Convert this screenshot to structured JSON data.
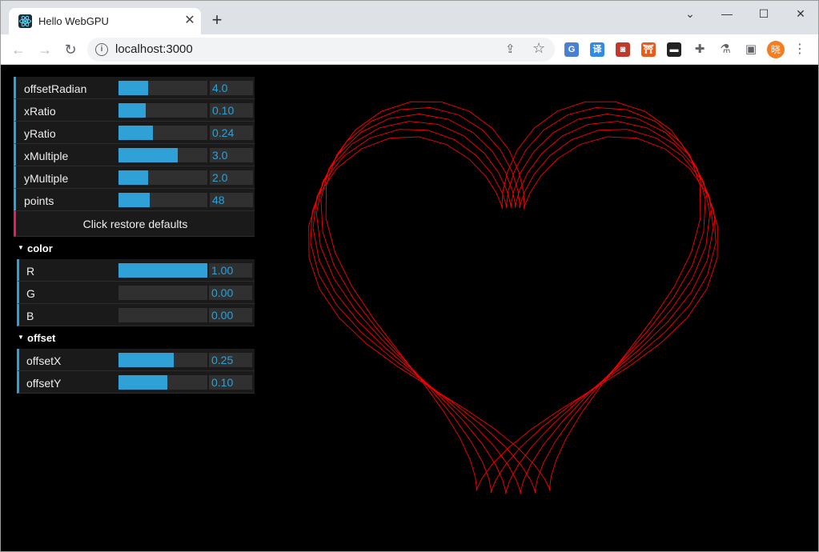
{
  "browser": {
    "tab_title": "Hello WebGPU",
    "tab_close": "✕",
    "new_tab": "+",
    "url": "localhost:3000",
    "profile_initial": "晓",
    "extensions": [
      {
        "name": "google-translate-icon",
        "glyph": "G",
        "color": "#4a7fd6"
      },
      {
        "name": "translate-icon",
        "glyph": "译",
        "color": "#2f8be6"
      },
      {
        "name": "extension-red-icon",
        "glyph": "◙",
        "color": "#c0392b"
      },
      {
        "name": "extension-orange-icon",
        "glyph": "⛩",
        "color": "#e85b1a"
      },
      {
        "name": "extension-dark-icon",
        "glyph": "▬",
        "color": "#222222"
      },
      {
        "name": "puzzle-icon",
        "glyph": "✚",
        "color": "#5f6368"
      },
      {
        "name": "flask-icon",
        "glyph": "⚗",
        "color": "#5f6368"
      },
      {
        "name": "sidepanel-icon",
        "glyph": "▣",
        "color": "#5f6368"
      }
    ]
  },
  "gui": {
    "controls": [
      {
        "label": "offsetRadian",
        "value": "4.0",
        "fraction": 0.33
      },
      {
        "label": "xRatio",
        "value": "0.10",
        "fraction": 0.31
      },
      {
        "label": "yRatio",
        "value": "0.24",
        "fraction": 0.39
      },
      {
        "label": "xMultiple",
        "value": "3.0",
        "fraction": 0.67
      },
      {
        "label": "yMultiple",
        "value": "2.0",
        "fraction": 0.33
      },
      {
        "label": "points",
        "value": "48",
        "fraction": 0.35
      }
    ],
    "restore_label": "Click restore defaults",
    "color": {
      "title": "color",
      "controls": [
        {
          "label": "R",
          "value": "1.00",
          "fraction": 1.0
        },
        {
          "label": "G",
          "value": "0.00",
          "fraction": 0.0
        },
        {
          "label": "B",
          "value": "0.00",
          "fraction": 0.0
        }
      ]
    },
    "offset": {
      "title": "offset",
      "controls": [
        {
          "label": "offsetX",
          "value": "0.25",
          "fraction": 0.625
        },
        {
          "label": "offsetY",
          "value": "0.10",
          "fraction": 0.55
        }
      ]
    }
  },
  "render": {
    "stroke_color": "#ff0000",
    "points": 48,
    "copies": 6
  }
}
